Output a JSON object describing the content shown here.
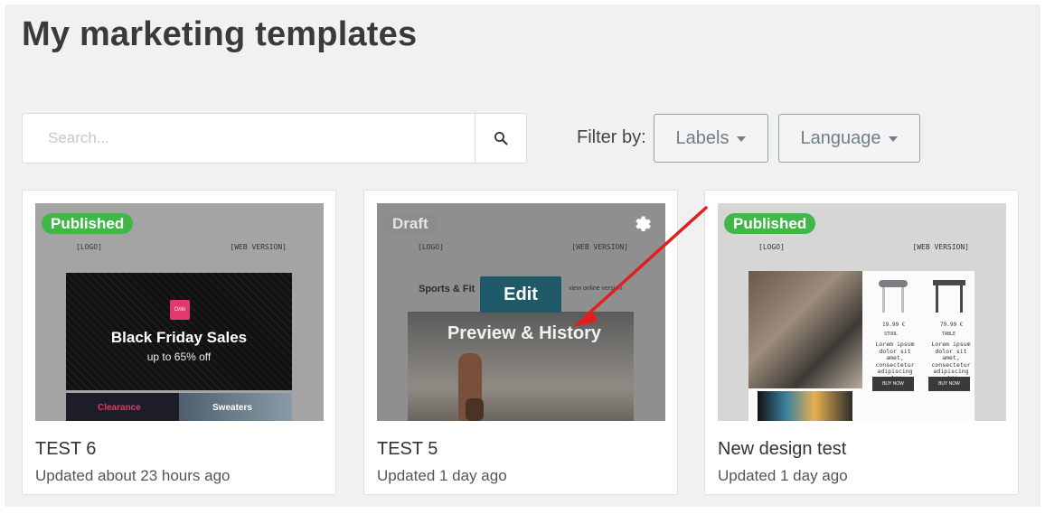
{
  "page": {
    "title": "My marketing templates"
  },
  "search": {
    "placeholder": "Search...",
    "value": "",
    "button_icon": "search-icon"
  },
  "filters": {
    "label": "Filter by:",
    "labels_button": "Labels",
    "language_button": "Language"
  },
  "cards": [
    {
      "status": "Published",
      "title": "TEST 6",
      "updated": "Updated about 23 hours ago",
      "thumb": {
        "logo_text": "[LOGO]",
        "header_right": "[WEB VERSION]",
        "brand_mark": "Onlo",
        "headline": "Black Friday Sales",
        "subline": "up to 65% off",
        "tile_left": "Clearance",
        "tile_right": "Sweaters"
      }
    },
    {
      "status": "Draft",
      "title": "TEST 5",
      "updated": "Updated 1 day ago",
      "thumb": {
        "logo_text": "[LOGO]",
        "header_right": "[WEB VERSION]",
        "headline": "Sports & Fit",
        "view_online": "view online version",
        "edit_label": "Edit",
        "preview_label": "Preview & History",
        "gear_icon": "gear-icon"
      }
    },
    {
      "status": "Published",
      "title": "New design test",
      "updated": "Updated 1 day ago",
      "thumb": {
        "logo_text": "[LOGO]",
        "header_right": "[WEB VERSION]",
        "price_1": "19.99 €",
        "product_1": "STOOL",
        "price_2": "79.99 €",
        "product_2": "TABLE",
        "lorem": "Lorem ipsum dolor sit amet, consectetur adipiscing elit",
        "buy_now": "BUY NOW"
      }
    }
  ],
  "colors": {
    "published": "#41b649",
    "draft": "#8c8c8c",
    "edit_button": "#1e5a68",
    "arrow": "#e02020",
    "filter_border": "#8ea1ac"
  }
}
